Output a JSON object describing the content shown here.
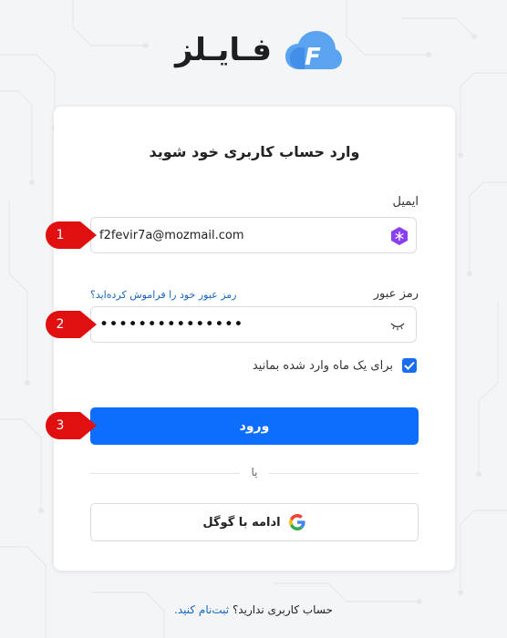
{
  "brand": {
    "name": "فـایـلز",
    "logo_letter": "F"
  },
  "form": {
    "title": "وارد حساب کاربری خود شوید",
    "email_label": "ایمیل",
    "email_value": "f2fevir7a@mozmail.com",
    "password_label": "رمز عبور",
    "password_masked": "•••••••••••••••",
    "forgot_link": "رمز عبور خود را فراموش کرده‌اید؟",
    "remember_label": "برای یک ماه وارد شده بمانید",
    "remember_checked": true,
    "login_button": "ورود",
    "or_text": "یا",
    "google_button": "ادامه با گوگل"
  },
  "footer": {
    "question": "حساب کاربری ندارید؟",
    "signup_link": "ثبت‌نام کنید."
  },
  "markers": [
    "1",
    "2",
    "3"
  ],
  "colors": {
    "primary": "#0d6efd",
    "link": "#1565c0",
    "marker": "#e01010",
    "background": "#f4f5f7"
  }
}
